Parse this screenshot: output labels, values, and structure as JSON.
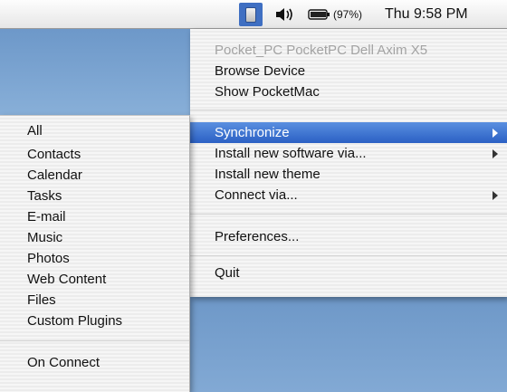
{
  "menubar": {
    "app_icon": "pocketmac-device-icon",
    "volume_icon": "speaker-volume-icon",
    "battery_icon": "battery-icon",
    "battery_percent": "(97%)",
    "clock": "Thu 9:58 PM"
  },
  "main_menu": {
    "device_name": "Pocket_PC PocketPC Dell Axim X5",
    "items": [
      {
        "label": "Browse Device"
      },
      {
        "label": "Show PocketMac"
      },
      {
        "label": "Synchronize"
      },
      {
        "label": "Install new software via..."
      },
      {
        "label": "Install new theme"
      },
      {
        "label": "Connect via..."
      },
      {
        "label": "Preferences..."
      },
      {
        "label": "Quit"
      }
    ]
  },
  "sync_submenu": {
    "items": [
      {
        "label": "All"
      },
      {
        "label": "Contacts"
      },
      {
        "label": "Calendar"
      },
      {
        "label": "Tasks"
      },
      {
        "label": "E-mail"
      },
      {
        "label": "Music"
      },
      {
        "label": "Photos"
      },
      {
        "label": "Web Content"
      },
      {
        "label": "Files"
      },
      {
        "label": "Custom Plugins"
      },
      {
        "label": "On Connect"
      }
    ]
  },
  "colors": {
    "selection": "#2b60c4",
    "desktop": "#7fa6cf",
    "disabled_text": "#a3a3a3"
  }
}
